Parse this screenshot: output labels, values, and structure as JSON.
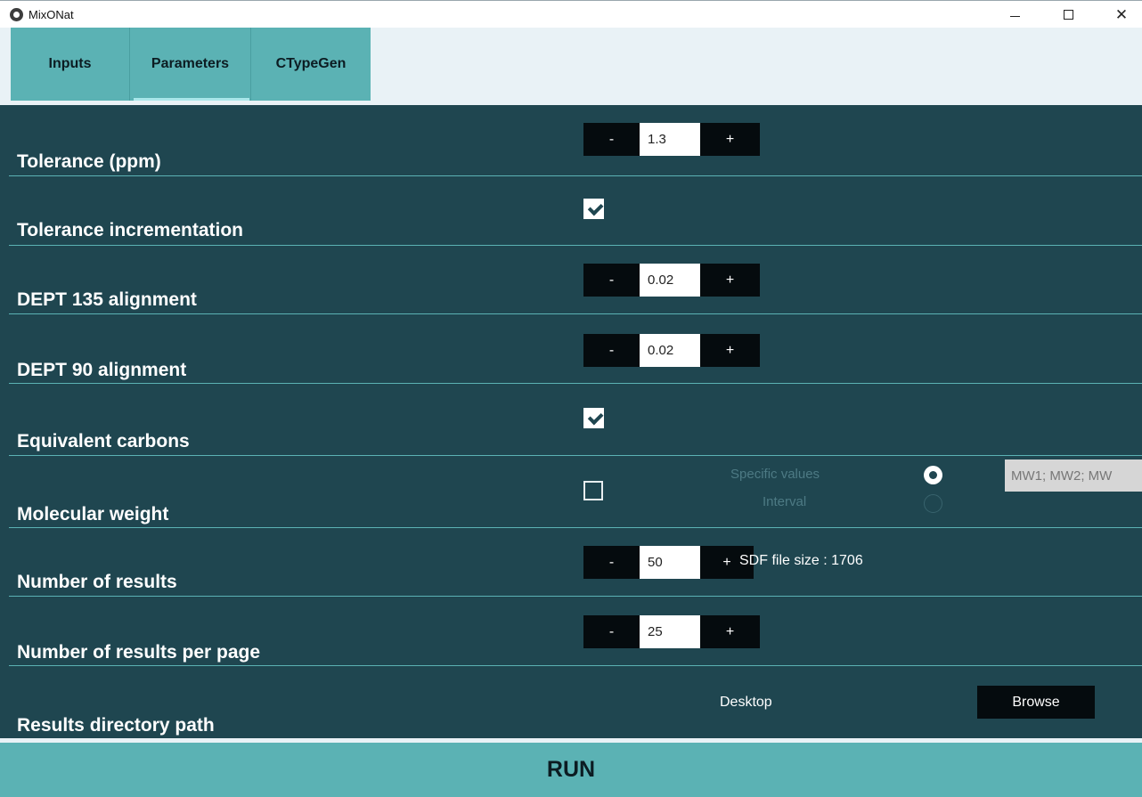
{
  "window": {
    "title": "MixONat",
    "min_glyph": "",
    "close_glyph": "✕"
  },
  "tabs": [
    {
      "label": "Inputs",
      "active": false
    },
    {
      "label": "Parameters",
      "active": true
    },
    {
      "label": "CTypeGen",
      "active": false
    }
  ],
  "params": {
    "tolerance": {
      "label": "Tolerance (ppm)",
      "value": "1.3",
      "minus": "-",
      "plus": "+"
    },
    "tolerance_incrementation": {
      "label": "Tolerance incrementation",
      "checked": true
    },
    "dept135": {
      "label": "DEPT 135 alignment",
      "value": "0.02",
      "minus": "-",
      "plus": "+"
    },
    "dept90": {
      "label": "DEPT 90 alignment",
      "value": "0.02",
      "minus": "-",
      "plus": "+"
    },
    "equivalent_carbons": {
      "label": "Equivalent carbons",
      "checked": true
    },
    "molecular_weight": {
      "label": "Molecular weight",
      "checked": false,
      "specific_values_label": "Specific values",
      "interval_label": "Interval",
      "selected": "Specific values",
      "input_placeholder": "MW1; MW2; MW"
    },
    "number_of_results": {
      "label": "Number of results",
      "value": "50",
      "minus": "-",
      "plus": "+",
      "sdf_size_text": "SDF file size : 1706"
    },
    "results_per_page": {
      "label": "Number of results per page",
      "value": "25",
      "minus": "-",
      "plus": "+"
    },
    "results_directory": {
      "label": "Results directory path",
      "path": "Desktop",
      "browse_label": "Browse"
    }
  },
  "run_label": "RUN"
}
